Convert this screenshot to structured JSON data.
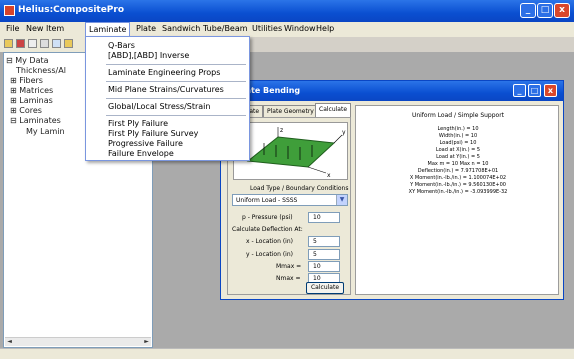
{
  "app": {
    "title": "Helius:CompositePro"
  },
  "window_buttons": {
    "minimize": "_",
    "maximize": "□",
    "close": "x"
  },
  "menu": [
    "File",
    "New Item",
    "Laminate",
    "Plate",
    "Sandwich",
    "Tube/Beam",
    "Utilities",
    "Window",
    "Help"
  ],
  "laminate_menu": {
    "groups": [
      [
        "Q-Bars",
        "[ABD],[ABD] Inverse"
      ],
      [
        "Laminate Engineering Props"
      ],
      [
        "Mid Plane Strains/Curvatures"
      ],
      [
        "Global/Local Stress/Strain"
      ],
      [
        "First Ply Failure",
        "First Ply Failure Survey",
        "Progressive Failure",
        "Failure Envelope"
      ]
    ]
  },
  "tree": {
    "items": [
      {
        "label": "My Data",
        "prefix": "⊟"
      },
      {
        "label": "Thickness/Al",
        "prefix": ""
      },
      {
        "label": "Fibers",
        "prefix": "⊞"
      },
      {
        "label": "Matrices",
        "prefix": "⊞"
      },
      {
        "label": "Laminas",
        "prefix": "⊞"
      },
      {
        "label": "Cores",
        "prefix": "⊞"
      },
      {
        "label": "Laminates",
        "prefix": "⊟"
      },
      {
        "label": "My Lamin",
        "prefix": ""
      }
    ]
  },
  "plate_window": {
    "title": "Plate Bending",
    "tabs": [
      "Laminate",
      "Plate Geometry",
      "Calculate"
    ],
    "active_tab": "Calculate",
    "load_type_label": "Load Type / Boundary Conditions",
    "load_type_value": "Uniform Load - SSSS",
    "pressure_label": "p - Pressure (psi)",
    "pressure_value": "10",
    "deflection_heading": "Calculate Deflection At:",
    "x_label": "x - Location (in)",
    "x_value": "5",
    "y_label": "y - Location (in)",
    "y_value": "5",
    "mmax_label": "Mmax =",
    "mmax_value": "10",
    "nmax_label": "Nmax =",
    "nmax_value": "10",
    "calculate_label": "Calculate",
    "diagram_axes": {
      "x": "x",
      "y": "y",
      "z": "z"
    }
  },
  "results": {
    "heading": "Uniform Load / Simple Support",
    "lines": [
      "Length(in.) = 10",
      "Width(in.) = 10",
      "Load(psi) = 10",
      "Load at X(in.) = 5",
      "Load at Y(in.) = 5",
      "Max m = 10  Max n = 10",
      "Deflection(in.) = 7.971708E+01",
      "X Moment(in.-lb./in.) = 1.100074E+02",
      "Y Moment(in.-lb./in.) = 9.560130E+00",
      "XY Moment(in.-lb./in.) = -3.093999E-32"
    ]
  },
  "colors": {
    "titlebar": "#0a4fd1",
    "plate_green": "#3f9e3a",
    "client_bg": "#aaaaaa"
  }
}
